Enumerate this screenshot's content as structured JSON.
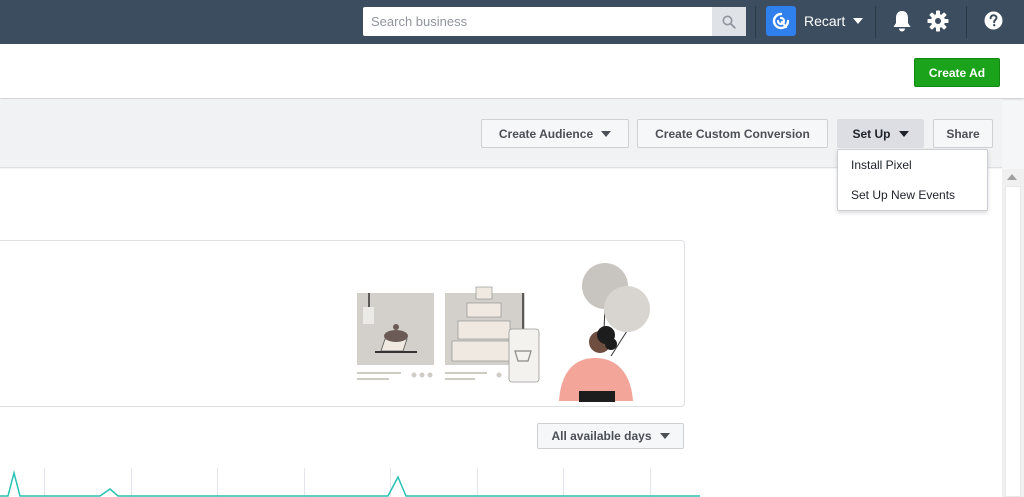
{
  "topbar": {
    "search_placeholder": "Search business",
    "account_name": "Recart",
    "icons": [
      "search-icon",
      "recart-logo-icon",
      "caret-down-icon",
      "bell-icon",
      "gear-icon",
      "help-icon"
    ]
  },
  "subbar": {
    "create_ad_label": "Create Ad"
  },
  "toolbar": {
    "create_audience_label": "Create Audience",
    "create_custom_conversion_label": "Create Custom Conversion",
    "setup_label": "Set Up",
    "share_label": "Share"
  },
  "setup_menu": {
    "items": [
      "Install Pixel",
      "Set Up New Events"
    ]
  },
  "main": {
    "date_range_label": "All available days"
  },
  "colors": {
    "topbar": "#3b4d5f",
    "create_ad": "#1ba31b",
    "chart_line": "#28c2b4",
    "illustration_gray": "#d3d0cb",
    "illustration_pink": "#f4a59a"
  }
}
